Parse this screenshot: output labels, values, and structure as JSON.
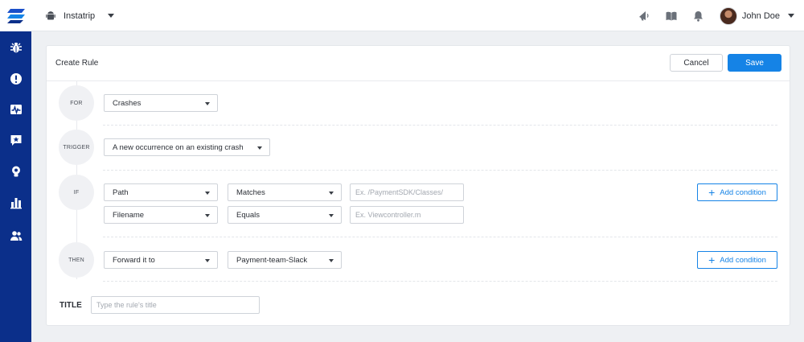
{
  "topbar": {
    "app_name": "Instatrip",
    "user_name": "John Doe"
  },
  "sidebar": {
    "items": [
      {
        "name": "bugs",
        "icon": "bug-icon"
      },
      {
        "name": "crashes",
        "icon": "alert-circle-icon"
      },
      {
        "name": "apm",
        "icon": "pulse-icon"
      },
      {
        "name": "feature-requests",
        "icon": "star-message-icon"
      },
      {
        "name": "announcements",
        "icon": "lightbulb-icon"
      },
      {
        "name": "analytics",
        "icon": "bar-chart-icon"
      },
      {
        "name": "team",
        "icon": "users-icon"
      }
    ]
  },
  "card": {
    "title": "Create Rule",
    "cancel_label": "Cancel",
    "save_label": "Save"
  },
  "steps": {
    "for": "FOR",
    "trigger": "TRIGGER",
    "if": "IF",
    "then": "THEN"
  },
  "rule": {
    "for_value": "Crashes",
    "trigger_value": "A new occurrence on an existing crash",
    "conditions": [
      {
        "field": "Path",
        "operator": "Matches",
        "placeholder": "Ex. /PaymentSDK/Classes/"
      },
      {
        "field": "Filename",
        "operator": "Equals",
        "placeholder": "Ex. Viewcontroller.m"
      }
    ],
    "action": "Forward it to",
    "action_target": "Payment-team-Slack",
    "add_condition_label": "Add condition"
  },
  "title_field": {
    "label": "TITLE",
    "placeholder": "Type the rule's title"
  },
  "colors": {
    "sidebar": "#0b2f8a",
    "accent": "#1583e6",
    "background": "#eef0f3"
  }
}
